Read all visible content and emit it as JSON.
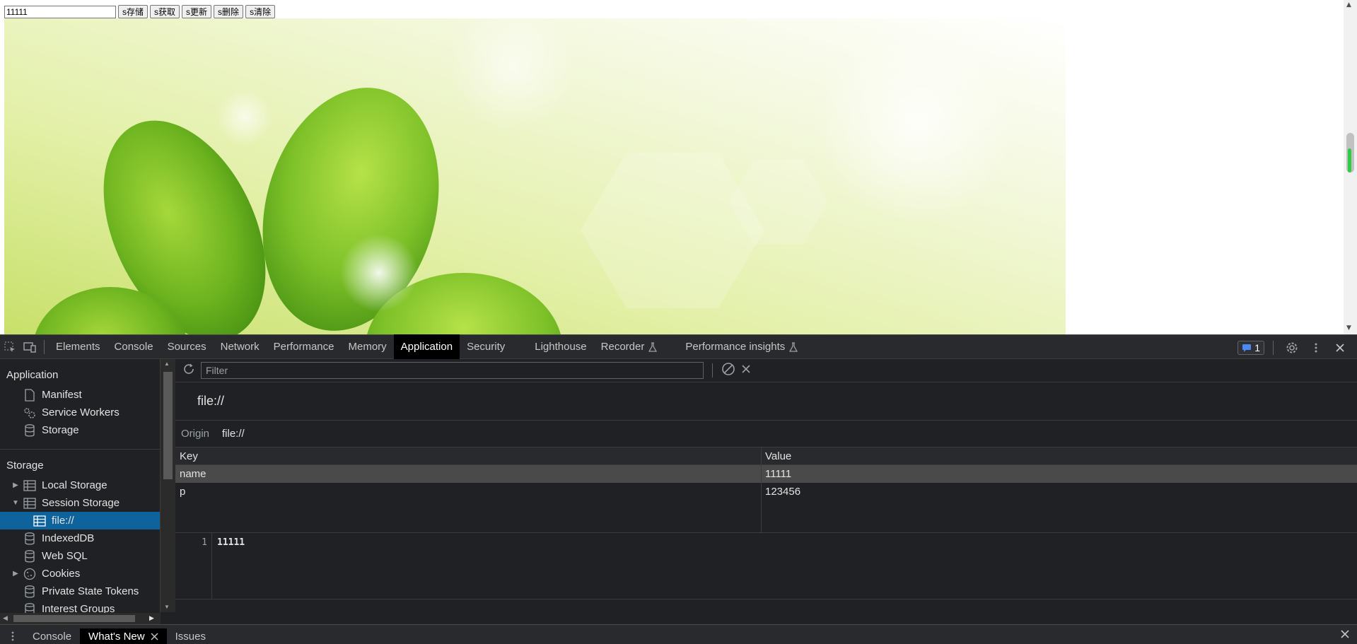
{
  "page": {
    "input_value": "11111",
    "buttons": [
      "s存储",
      "s获取",
      "s更新",
      "s删除",
      "s清除"
    ]
  },
  "devtools": {
    "tabs": [
      "Elements",
      "Console",
      "Sources",
      "Network",
      "Performance",
      "Memory",
      "Application",
      "Security",
      "Lighthouse",
      "Recorder",
      "Performance insights"
    ],
    "active_tab": "Application",
    "issues_count": "1",
    "sidebar": {
      "application_title": "Application",
      "application_items": [
        "Manifest",
        "Service Workers",
        "Storage"
      ],
      "storage_title": "Storage",
      "storage_items": {
        "local_storage": "Local Storage",
        "session_storage": "Session Storage",
        "session_child": "file://",
        "indexeddb": "IndexedDB",
        "websql": "Web SQL",
        "cookies": "Cookies",
        "private_state_tokens": "Private State Tokens",
        "interest_groups": "Interest Groups"
      }
    },
    "main": {
      "filter_placeholder": "Filter",
      "origin_title": "file://",
      "origin_label": "Origin",
      "origin_value": "file://",
      "columns": [
        "Key",
        "Value"
      ],
      "rows": [
        {
          "key": "name",
          "value": "11111"
        },
        {
          "key": "p",
          "value": "123456"
        }
      ],
      "preview_line_number": "1",
      "preview_value": "11111"
    },
    "drawer": {
      "tabs": [
        "Console",
        "What's New",
        "Issues"
      ],
      "active_tab": "What's New"
    }
  }
}
